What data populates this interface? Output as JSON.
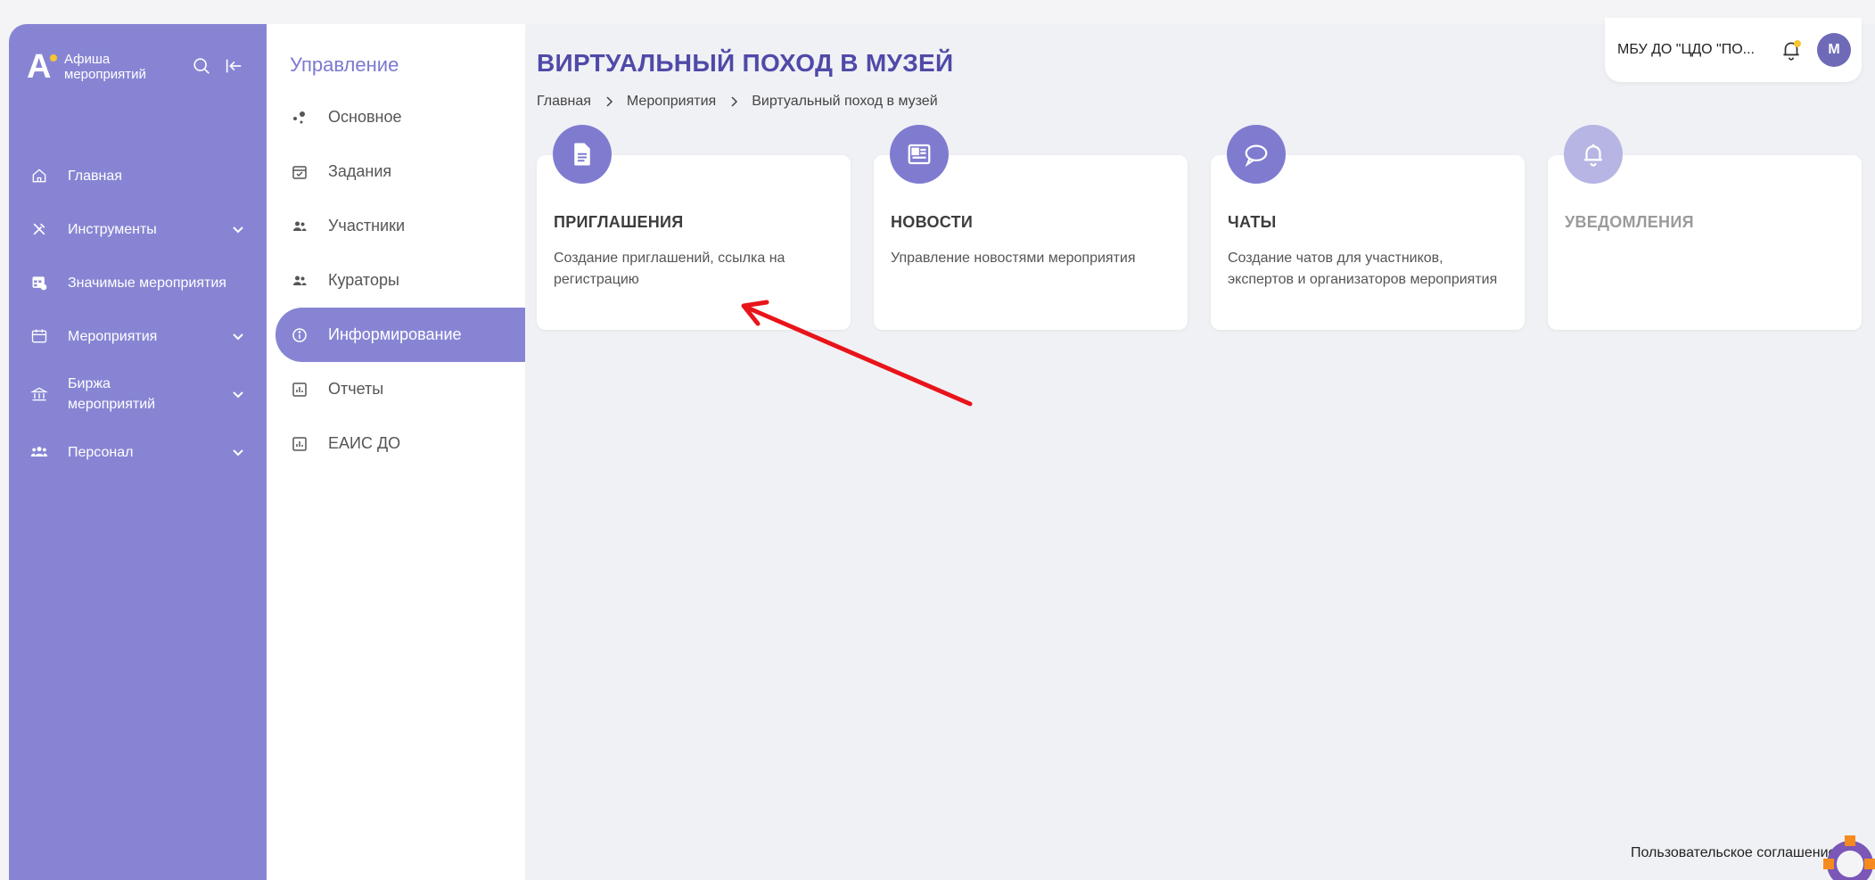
{
  "sidebar": {
    "logo_text": "Афиша мероприятий",
    "items": [
      {
        "label": "Главная",
        "icon": "home-icon",
        "has_chevron": false
      },
      {
        "label": "Инструменты",
        "icon": "tools-icon",
        "has_chevron": true
      },
      {
        "label": "Значимые мероприятия",
        "icon": "calendar-star-icon",
        "has_chevron": false
      },
      {
        "label": "Мероприятия",
        "icon": "calendar-icon",
        "has_chevron": true
      },
      {
        "label": "Биржа мероприятий",
        "icon": "bank-icon",
        "has_chevron": true
      },
      {
        "label": "Персонал",
        "icon": "people-icon",
        "has_chevron": true
      }
    ]
  },
  "subnav": {
    "title": "Управление",
    "items": [
      {
        "label": "Основное",
        "icon": "dots-icon"
      },
      {
        "label": "Задания",
        "icon": "calendar-check-icon"
      },
      {
        "label": "Участники",
        "icon": "users-icon"
      },
      {
        "label": "Кураторы",
        "icon": "users-icon"
      },
      {
        "label": "Информирование",
        "icon": "info-icon",
        "active": true
      },
      {
        "label": "Отчеты",
        "icon": "chart-icon"
      },
      {
        "label": "ЕАИС ДО",
        "icon": "chart-icon"
      }
    ]
  },
  "main": {
    "title": "ВИРТУАЛЬНЫЙ ПОХОД В МУЗЕЙ",
    "breadcrumb": [
      "Главная",
      "Мероприятия",
      "Виртуальный поход в музей"
    ],
    "cards": [
      {
        "title": "ПРИГЛАШЕНИЯ",
        "desc": "Создание приглашений, ссылка на регистрацию",
        "icon": "document-icon"
      },
      {
        "title": "НОВОСТИ",
        "desc": "Управление новостями мероприятия",
        "icon": "newspaper-icon"
      },
      {
        "title": "ЧАТЫ",
        "desc": "Создание чатов для участников, экспертов и организаторов мероприятия",
        "icon": "chat-icon"
      },
      {
        "title": "УВЕДОМЛЕНИЯ",
        "desc": "",
        "icon": "bell-icon",
        "faded": true
      }
    ]
  },
  "header": {
    "org": "МБУ ДО \"ЦДО \"ПО...",
    "avatar_letter": "М"
  },
  "footer": {
    "agreement": "Пользовательское соглашение"
  },
  "colors": {
    "accent": "#8785d3",
    "title": "#4f4aa8",
    "annotation_arrow": "#e8141a"
  }
}
